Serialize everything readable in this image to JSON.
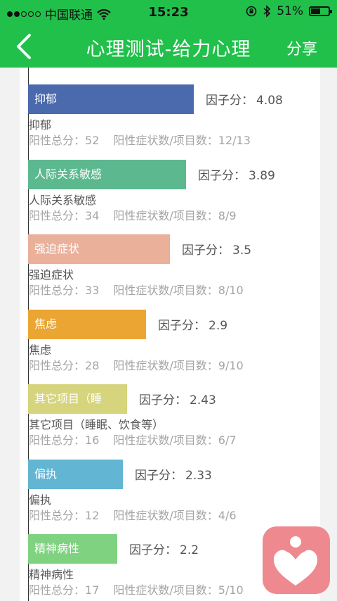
{
  "status_bar": {
    "carrier": "中国联通",
    "time": "15:23",
    "battery_percent": "51%",
    "battery_level": 0.51
  },
  "nav": {
    "title": "心理测试-给力心理",
    "share_label": "分享"
  },
  "labels": {
    "factor_label": "因子分：",
    "positive_total_label": "阳性总分：",
    "positive_symptoms_label": "阳性症状数/项目数：",
    "app_icon": "heart-person-icon"
  },
  "chart_data": {
    "type": "bar",
    "orientation": "horizontal",
    "xlim": [
      0,
      5
    ],
    "colors": [
      "#4a6aad",
      "#5cb88f",
      "#eab09a",
      "#eba533",
      "#d6d47c",
      "#62b6d4",
      "#7fd280"
    ],
    "items": [
      {
        "bar_label": "抑郁",
        "name": "抑郁",
        "factor": "4.08",
        "value": 4.08,
        "positive_total": "52",
        "ratio": "12/13"
      },
      {
        "bar_label": "人际关系敏感",
        "name": "人际关系敏感",
        "factor": "3.89",
        "value": 3.89,
        "positive_total": "34",
        "ratio": "8/9"
      },
      {
        "bar_label": "强迫症状",
        "name": "强迫症状",
        "factor": "3.5",
        "value": 3.5,
        "positive_total": "33",
        "ratio": "8/10"
      },
      {
        "bar_label": "焦虑",
        "name": "焦虑",
        "factor": "2.9",
        "value": 2.9,
        "positive_total": "28",
        "ratio": "9/10"
      },
      {
        "bar_label": "其它项目（睡",
        "name": "其它项目（睡眠、饮食等）",
        "factor": "2.43",
        "value": 2.43,
        "positive_total": "16",
        "ratio": "6/7"
      },
      {
        "bar_label": "偏执",
        "name": "偏执",
        "factor": "2.33",
        "value": 2.33,
        "positive_total": "12",
        "ratio": "4/6"
      },
      {
        "bar_label": "精神病性",
        "name": "精神病性",
        "factor": "2.2",
        "value": 2.2,
        "positive_total": "17",
        "ratio": "5/10"
      }
    ]
  }
}
